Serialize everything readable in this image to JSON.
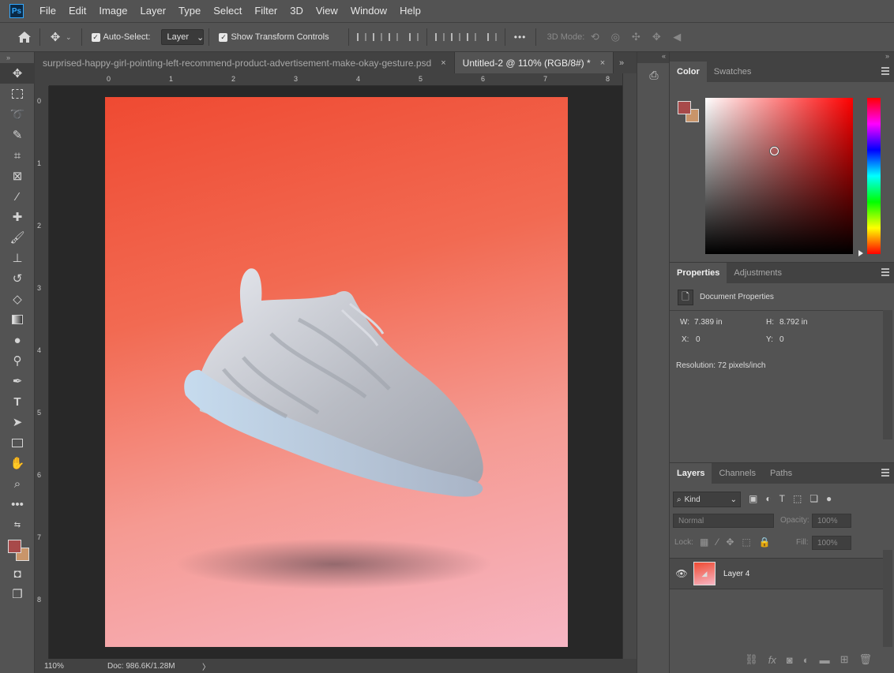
{
  "app": {
    "logo_text": "Ps"
  },
  "menu": [
    "File",
    "Edit",
    "Image",
    "Layer",
    "Type",
    "Select",
    "Filter",
    "3D",
    "View",
    "Window",
    "Help"
  ],
  "options": {
    "auto_select_label": "Auto-Select:",
    "auto_select_checked": true,
    "auto_select_target": "Layer",
    "show_transform_label": "Show Transform Controls",
    "show_transform_checked": true,
    "more_label": "•••",
    "mode3d_label": "3D Mode:"
  },
  "tabs": [
    {
      "label": "surprised-happy-girl-pointing-left-recommend-product-advertisement-make-okay-gesture.psd",
      "close": "×",
      "active": false
    },
    {
      "label": "Untitled-2 @ 110% (RGB/8#) *",
      "close": "×",
      "active": true
    }
  ],
  "rulers": {
    "h": [
      "0",
      "1",
      "2",
      "3",
      "4",
      "5",
      "6",
      "7",
      "8"
    ],
    "v": [
      "0",
      "1",
      "2",
      "3",
      "4",
      "5",
      "6",
      "7",
      "8"
    ]
  },
  "status": {
    "zoom": "110%",
    "doc": "Doc: 986.6K/1.28M",
    "arrow": "〉"
  },
  "colors": {
    "foreground": "#a84a4a",
    "background": "#c9956a",
    "accent": "#31a8ff"
  },
  "panels": {
    "color": {
      "tabs": [
        "Color",
        "Swatches"
      ]
    },
    "properties": {
      "tabs": [
        "Properties",
        "Adjustments"
      ],
      "doc_label": "Document Properties",
      "w_label": "W:",
      "w_value": "7.389 in",
      "h_label": "H:",
      "h_value": "8.792 in",
      "x_label": "X:",
      "x_value": "0",
      "y_label": "Y:",
      "y_value": "0",
      "resolution": "Resolution: 72 pixels/inch"
    },
    "layers": {
      "tabs": [
        "Layers",
        "Channels",
        "Paths"
      ],
      "kind_label": "Kind",
      "blend_mode": "Normal",
      "opacity_label": "Opacity:",
      "opacity_value": "100%",
      "lock_label": "Lock:",
      "fill_label": "Fill:",
      "fill_value": "100%",
      "layer_name": "Layer 4"
    }
  },
  "icons": [
    "ps-logo",
    "home-icon",
    "move-icon",
    "marquee-icon",
    "lasso-icon",
    "quick-select-icon",
    "crop-icon",
    "frame-icon",
    "eyedropper-icon",
    "healing-icon",
    "brush-icon",
    "stamp-icon",
    "history-brush-icon",
    "eraser-icon",
    "gradient-icon",
    "blur-icon",
    "dodge-icon",
    "pen-icon",
    "type-icon",
    "path-select-icon",
    "rectangle-icon",
    "hand-icon",
    "zoom-icon",
    "more-icon",
    "eye-icon",
    "link-icon",
    "fx-icon",
    "mask-icon",
    "adjustment-icon",
    "folder-icon",
    "new-layer-icon",
    "trash-icon"
  ]
}
